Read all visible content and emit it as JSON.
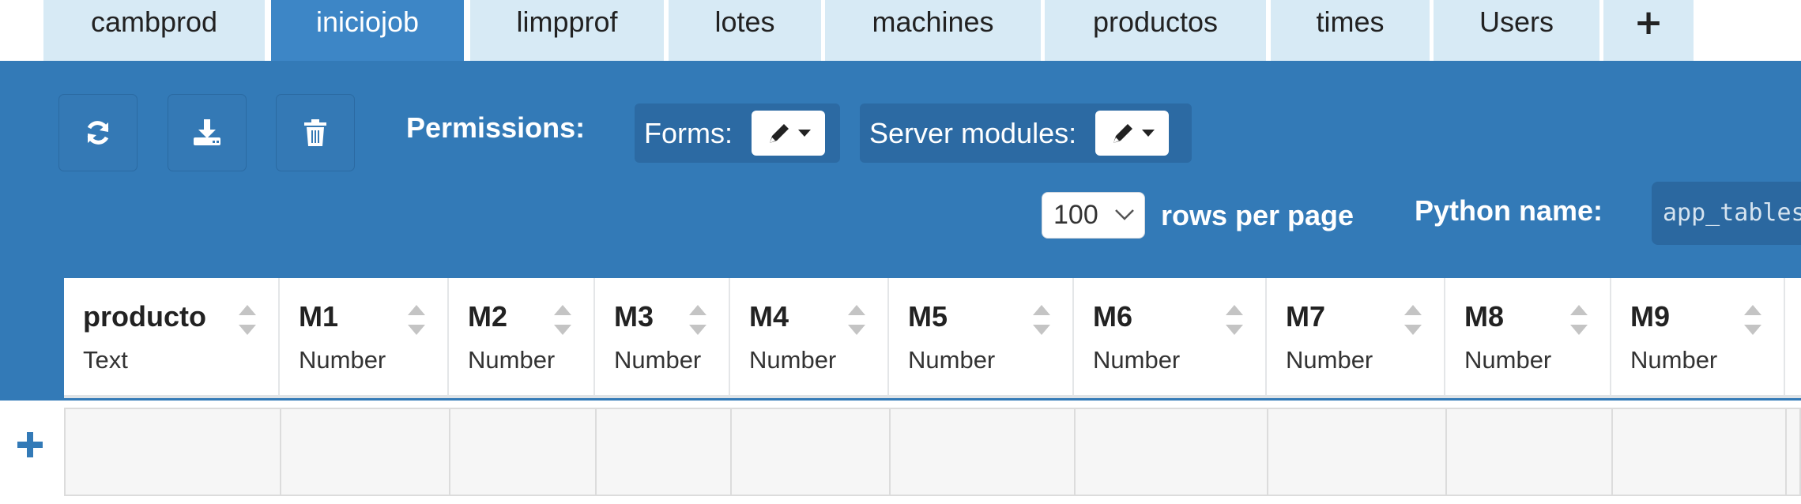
{
  "tabs": [
    {
      "label": "cambprod",
      "active": false
    },
    {
      "label": "iniciojob",
      "active": true
    },
    {
      "label": "limpprof",
      "active": false
    },
    {
      "label": "lotes",
      "active": false
    },
    {
      "label": "machines",
      "active": false
    },
    {
      "label": "productos",
      "active": false
    },
    {
      "label": "times",
      "active": false
    },
    {
      "label": "Users",
      "active": false
    }
  ],
  "add_tab_symbol": "+",
  "toolbar": {
    "refresh_icon": "refresh-icon",
    "download_icon": "download-icon",
    "delete_icon": "trash-icon",
    "permissions_label": "Permissions:",
    "forms_label": "Forms:",
    "server_modules_label": "Server modules:",
    "permission_icon": "pencil-icon"
  },
  "pagination": {
    "rows_per_page_value": "100",
    "rows_per_page_label": "rows per page"
  },
  "python_name": {
    "label": "Python name:",
    "value": "app_tables.iniciojob"
  },
  "columns": [
    {
      "name": "producto",
      "type": "Text"
    },
    {
      "name": "M1",
      "type": "Number"
    },
    {
      "name": "M2",
      "type": "Number"
    },
    {
      "name": "M3",
      "type": "Number"
    },
    {
      "name": "M4",
      "type": "Number"
    },
    {
      "name": "M5",
      "type": "Number"
    },
    {
      "name": "M6",
      "type": "Number"
    },
    {
      "name": "M7",
      "type": "Number"
    },
    {
      "name": "M8",
      "type": "Number"
    },
    {
      "name": "M9",
      "type": "Number"
    }
  ],
  "colors": {
    "panel": "#337ab7",
    "tab_active": "#3d86c6",
    "tab_inactive": "#d7eaf5"
  }
}
